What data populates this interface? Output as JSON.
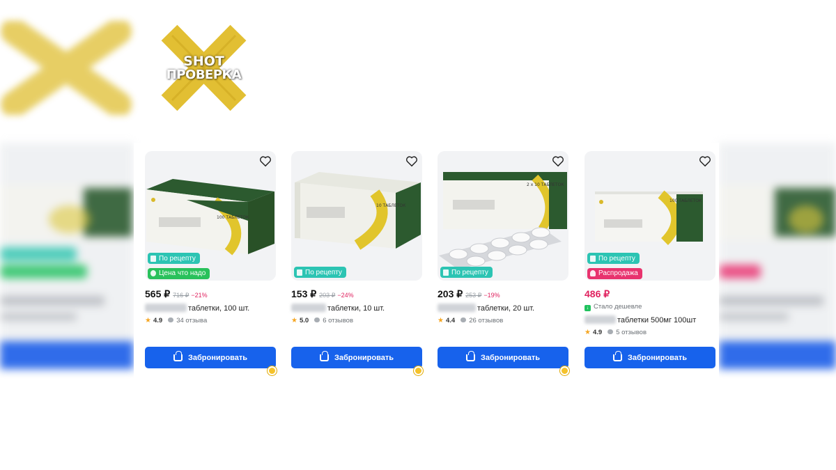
{
  "logo": {
    "line1": "SHOT",
    "line2": "ПРОВЕРКА"
  },
  "colors": {
    "accent": "#1762ec",
    "sale": "#e0225f",
    "prescription": "#2cc4b3",
    "good_price": "#29c15b",
    "star": "#f5a623"
  },
  "products": [
    {
      "image_text": "100 ТАБЛЕТОК",
      "badges": [
        {
          "label": "По рецепту",
          "type": "prescription"
        },
        {
          "label": "Цена что надо",
          "type": "good-price"
        }
      ],
      "price": "565 ₽",
      "old_price": "716 ₽",
      "discount": "−21%",
      "name": "таблетки, 100 шт.",
      "rating": "4.9",
      "reviews": "34 отзыва",
      "button": "Забронировать"
    },
    {
      "image_text": "10 ТАБЛЕТОК",
      "badges": [
        {
          "label": "По рецепту",
          "type": "prescription"
        }
      ],
      "price": "153 ₽",
      "old_price": "203 ₽",
      "discount": "−24%",
      "name": "таблетки, 10 шт.",
      "rating": "5.0",
      "reviews": "6 отзывов",
      "button": "Забронировать"
    },
    {
      "image_text": "2 x 10 ТАБЛЕТОК",
      "badges": [
        {
          "label": "По рецепту",
          "type": "prescription"
        }
      ],
      "price": "203 ₽",
      "old_price": "253 ₽",
      "discount": "−19%",
      "name": "таблетки, 20 шт.",
      "rating": "4.4",
      "reviews": "26 отзывов",
      "button": "Забронировать"
    },
    {
      "image_text": "100 ТАБЛЕТОК",
      "badges": [
        {
          "label": "По рецепту",
          "type": "prescription"
        },
        {
          "label": "Распродажа",
          "type": "sale"
        }
      ],
      "price": "486 ₽",
      "cheaper_label": "Стало дешевле",
      "name": "таблетки 500мг 100шт",
      "rating": "4.9",
      "reviews": "5 отзывов",
      "button": "Забронировать"
    }
  ]
}
